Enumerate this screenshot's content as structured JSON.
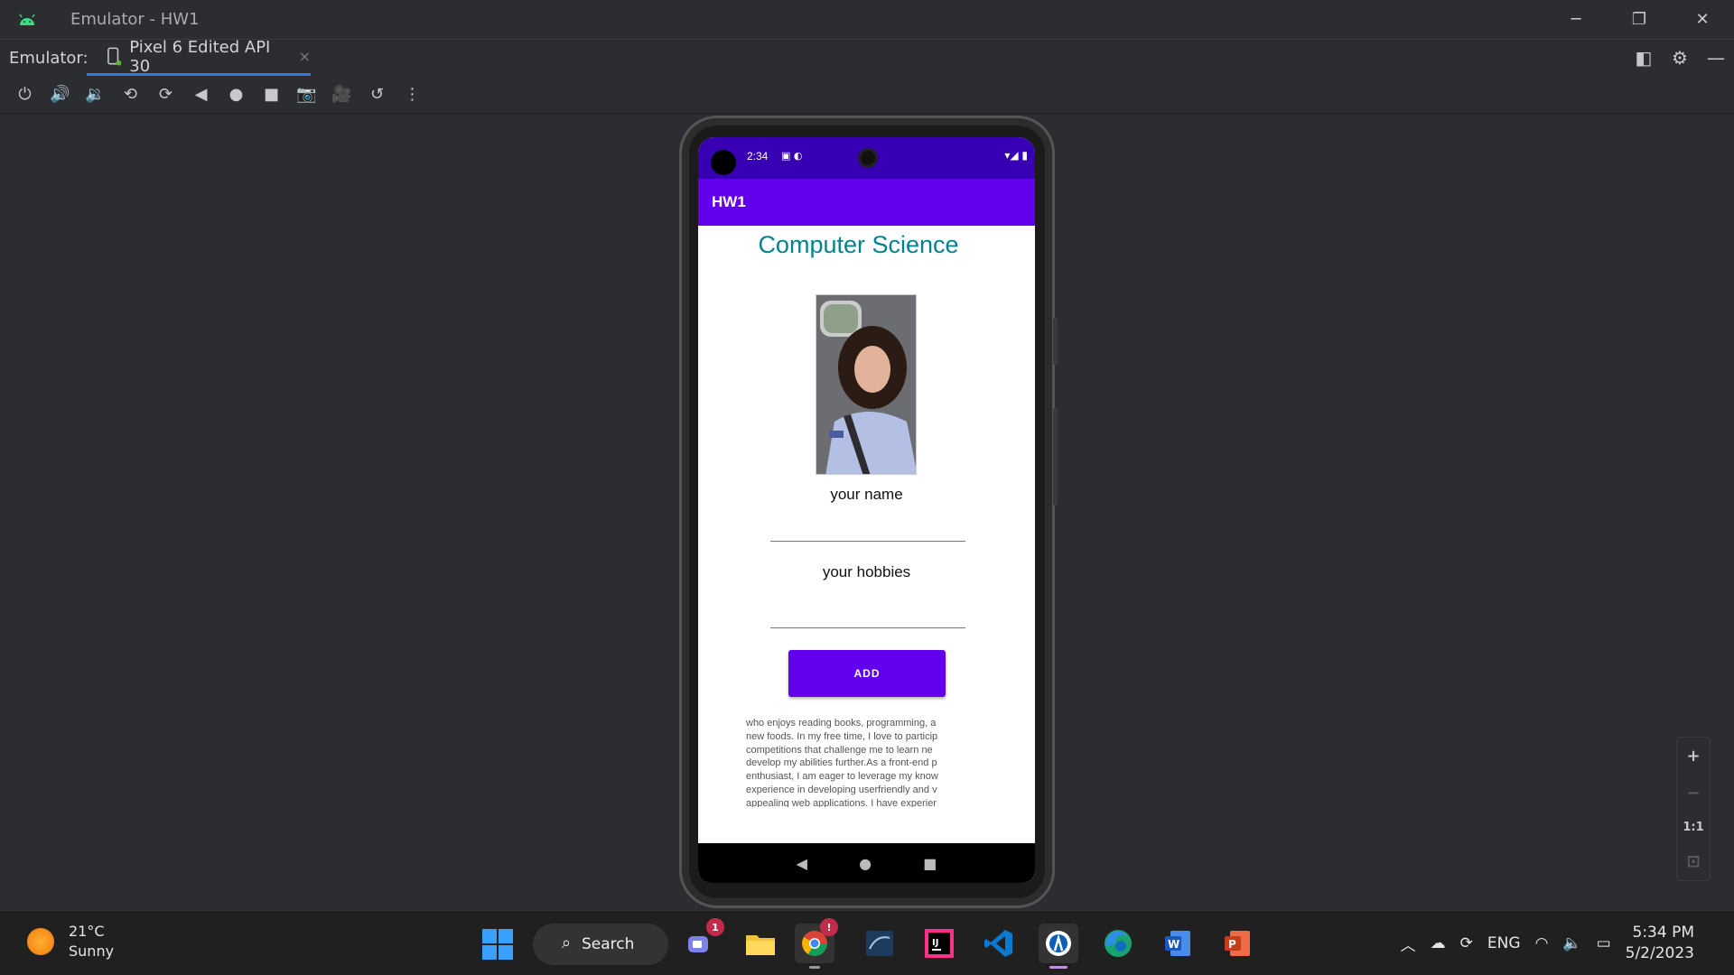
{
  "window": {
    "title": "Emulator - HW1",
    "minimize": "─",
    "restore": "❐",
    "close": "✕"
  },
  "tabs": {
    "label": "Emulator:",
    "device_tab": "Pixel 6 Edited API 30",
    "close_glyph": "×"
  },
  "toolbar": {
    "items": [
      {
        "name": "power",
        "glyph": "⏻"
      },
      {
        "name": "volume-up",
        "glyph": "🔊"
      },
      {
        "name": "volume-down",
        "glyph": "🔉"
      },
      {
        "name": "rotate-left",
        "glyph": "⟲"
      },
      {
        "name": "rotate-right",
        "glyph": "⟳"
      },
      {
        "name": "back",
        "glyph": "◀"
      },
      {
        "name": "home",
        "glyph": "●"
      },
      {
        "name": "overview",
        "glyph": "■"
      },
      {
        "name": "screenshot",
        "glyph": "📷"
      },
      {
        "name": "record",
        "glyph": "🎥"
      },
      {
        "name": "snapshot",
        "glyph": "↺"
      },
      {
        "name": "more",
        "glyph": "⋮"
      }
    ]
  },
  "phone": {
    "status_time": "2:34",
    "app_title": "HW1",
    "heading": "Computer Science",
    "name_label": "your name",
    "hobby_label": "your hobbies",
    "add_button": "ADD",
    "bio_lines": [
      "who enjoys reading books, programming, a",
      "new foods. In my free time, I love to particip",
      "competitions that challenge me to learn ne",
      "develop my abilities further.As a front-end p",
      "enthusiast, I am eager to leverage my know",
      "experience in developing userfriendly and v",
      "appealing web applications. I have experier"
    ],
    "nav_back": "◀",
    "nav_home": "●",
    "nav_recent": "■"
  },
  "zoom": {
    "zoom_in": "+",
    "zoom_out": "−",
    "actual": "1:1",
    "fit": "⊡"
  },
  "taskbar": {
    "temperature": "21°C",
    "condition": "Sunny",
    "search": "Search",
    "teams_badge": "1",
    "chrome_badge": "!",
    "language": "ENG",
    "time": "5:34 PM",
    "date": "5/2/2023"
  },
  "colors": {
    "status_bar": "#3700b3",
    "app_bar": "#6200ee",
    "heading": "#00838f",
    "tab_underline": "#3574f0"
  }
}
